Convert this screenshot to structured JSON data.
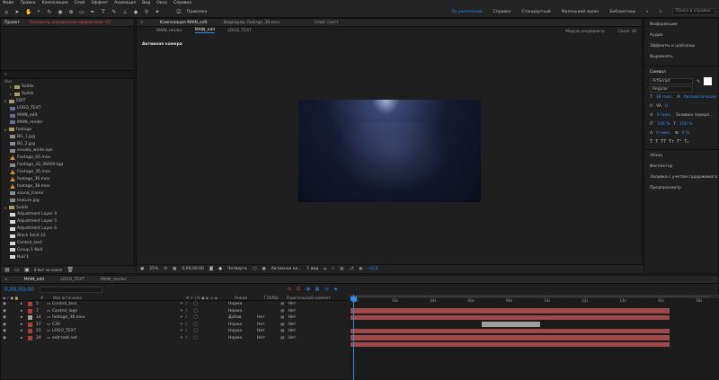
{
  "menubar": {
    "items": [
      "Файл",
      "Правка",
      "Композиция",
      "Слой",
      "Эффект",
      "Анимация",
      "Вид",
      "Окно",
      "Справка"
    ]
  },
  "toolbar": {
    "icons": [
      "home-icon",
      "selection-tool-icon",
      "hand-tool-icon",
      "zoom-tool-icon",
      "rotate-tool-icon",
      "camera-tool-icon",
      "pan-behind-icon",
      "rectangle-tool-icon",
      "pen-tool-icon",
      "type-tool-icon",
      "brush-tool-icon",
      "clone-stamp-icon",
      "eraser-icon",
      "roto-brush-icon",
      "puppet-pin-icon"
    ],
    "snapping_label": "Привязка",
    "workspaces": [
      "По умолчанию",
      "Справка",
      "Стандартный",
      "Маленький экран",
      "Библиотеки"
    ],
    "active_workspace": "По умолчанию",
    "search_placeholder": "Поиск в справке"
  },
  "project_panel": {
    "tabs": [
      "Проект",
      "Элементы управления эффектами: ICI"
    ],
    "search_placeholder": "",
    "items": [
      {
        "label": "Solids",
        "type": "folder",
        "indent": 1
      },
      {
        "label": "Solids",
        "type": "folder",
        "indent": 1
      },
      {
        "label": "EDIT",
        "type": "folder",
        "indent": 0
      },
      {
        "label": "LOGO_TEXT",
        "type": "comp",
        "indent": 1
      },
      {
        "label": "MAIN_edit",
        "type": "comp",
        "indent": 1
      },
      {
        "label": "MAIN_render",
        "type": "comp",
        "indent": 1
      },
      {
        "label": "footage",
        "type": "folder",
        "indent": 0
      },
      {
        "label": "BG_1.jpg",
        "type": "footage",
        "indent": 1
      },
      {
        "label": "BG_2.jpg",
        "type": "footage",
        "indent": 1
      },
      {
        "label": "envato_white.eps",
        "type": "footage",
        "indent": 1
      },
      {
        "label": "Footage_05.mov",
        "type": "avi",
        "indent": 1
      },
      {
        "label": "Footage_32_36000.tga",
        "type": "footage",
        "indent": 1
      },
      {
        "label": "Footage_35.mov",
        "type": "avi",
        "indent": 1
      },
      {
        "label": "footage_36.mov",
        "type": "avi",
        "indent": 1
      },
      {
        "label": "footage_38.mov",
        "type": "avi",
        "indent": 1
      },
      {
        "label": "sound_frame",
        "type": "footage",
        "indent": 1
      },
      {
        "label": "texture.jpg",
        "type": "footage",
        "indent": 1
      },
      {
        "label": "Solids",
        "type": "folder",
        "indent": 0
      },
      {
        "label": "Adjustment Layer 4",
        "type": "solid",
        "indent": 1
      },
      {
        "label": "Adjustment Layer 5",
        "type": "solid",
        "indent": 1
      },
      {
        "label": "Adjustment Layer 6",
        "type": "solid",
        "indent": 1
      },
      {
        "label": "Black Solid 12",
        "type": "solid",
        "indent": 1
      },
      {
        "label": "Control_text",
        "type": "solid",
        "indent": 1
      },
      {
        "label": "Group 1 Null",
        "type": "solid",
        "indent": 1
      },
      {
        "label": "Null 1",
        "type": "solid",
        "indent": 1
      }
    ],
    "bpc": "8 бит на канал"
  },
  "comp_panel": {
    "tabs": [
      "Композиция MAIN_edit",
      "Видеоряд: footage_38.mov",
      "Слой: (нет)"
    ],
    "subtabs": [
      "MAIN_render",
      "MAIN_edit",
      "LOGO_TEXT"
    ],
    "active_camera": "Активная камера",
    "renderer": "Модуль рендеринга:",
    "renderer_value": "Classic 3D",
    "zoom": "25%",
    "timecode": "0;00;00;00",
    "resolution": "Четверть",
    "view": "Активная ка...",
    "views_count": "1 вид",
    "exposure": "+0,0"
  },
  "right_panel": {
    "items": [
      "Информация",
      "Аудио",
      "Эффекты и шаблоны",
      "Выровнять"
    ],
    "character_label": "Символ",
    "font": "ArtScript",
    "font_style": "Regular",
    "size": "36 пикс.",
    "leading": "Автоматически",
    "tracking": "0",
    "stroke_width": "0 пикс.",
    "stroke_mode": "Заливка поверх...",
    "vertical_scale": "100 %",
    "horizontal_scale": "100 %",
    "baseline": "0 пикс.",
    "tsume": "0 %",
    "sections": [
      "Абзац",
      "Инспектор",
      "Заливка с учетом содержимого",
      "Предпросмотр"
    ]
  },
  "timeline": {
    "tabs": [
      "MAIN_edit",
      "LOGO_TEXT",
      "MAIN_render"
    ],
    "timecode": "0;00;00;00",
    "col_num": "#",
    "col_name": "Имя источника",
    "col_mode": "Режим",
    "col_trkmat": "T TrkMat",
    "col_parent": "Родительский элемент",
    "ruler": [
      "0s",
      "02s",
      "04s",
      "06s",
      "08s",
      "10s",
      "12s",
      "14s",
      "16s",
      "18s"
    ],
    "layers": [
      {
        "num": "5",
        "name": "Control_text",
        "color": "#b23b3b",
        "mode": "Норма",
        "trk": "",
        "parent": "Нет"
      },
      {
        "num": "7",
        "name": "Control_logo",
        "color": "#b23b3b",
        "mode": "Норма",
        "trk": "",
        "parent": "Нет"
      },
      {
        "num": "14",
        "name": "footage_38.mov",
        "color": "#a0a0a0",
        "mode": "Добав",
        "trk": "Нет",
        "parent": "Нет"
      },
      {
        "num": "17",
        "name": "C30",
        "color": "#b23b3b",
        "mode": "Норма",
        "trk": "Нет",
        "parent": "Нет"
      },
      {
        "num": "21",
        "name": "LOGO_TEXT",
        "color": "#b23b3b",
        "mode": "Норма",
        "trk": "Нет",
        "parent": "Нет"
      },
      {
        "num": "24",
        "name": "edit text.net",
        "color": "#b23b3b",
        "mode": "Норма",
        "trk": "Нет",
        "parent": "Нет"
      }
    ]
  }
}
